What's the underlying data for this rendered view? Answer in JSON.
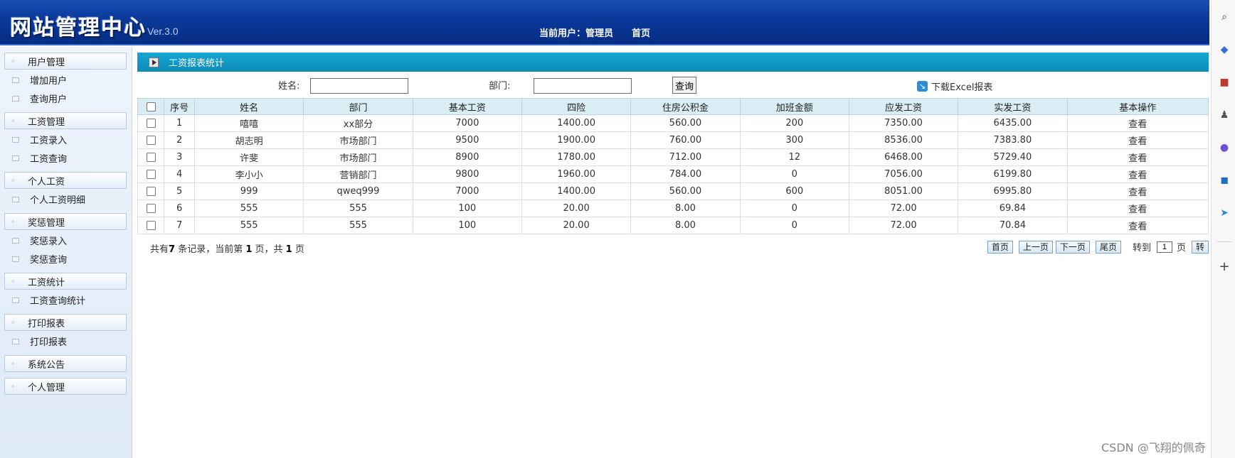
{
  "header": {
    "logo": "网站管理中心",
    "version": "Ver.3.0",
    "current_user_label": "当前用户：管理员",
    "home_link": "首页"
  },
  "sidebar": {
    "groups": [
      {
        "label": "用户管理",
        "items": [
          "增加用户",
          "查询用户"
        ]
      },
      {
        "label": "工资管理",
        "items": [
          "工资录入",
          "工资查询"
        ]
      },
      {
        "label": "个人工资",
        "items": [
          "个人工资明细"
        ]
      },
      {
        "label": "奖惩管理",
        "items": [
          "奖惩录入",
          "奖惩查询"
        ]
      },
      {
        "label": "工资统计",
        "items": [
          "工资查询统计"
        ]
      },
      {
        "label": "打印报表",
        "items": [
          "打印报表"
        ]
      },
      {
        "label": "系统公告",
        "items": []
      },
      {
        "label": "个人管理",
        "items": []
      }
    ]
  },
  "main": {
    "title": "工资报表统计",
    "search": {
      "name_label": "姓名:",
      "name_value": "",
      "dept_label": "部门:",
      "dept_value": "",
      "query_button": "查询",
      "excel_label": "下载Excel报表"
    },
    "table": {
      "headers": [
        "序号",
        "姓名",
        "部门",
        "基本工资",
        "四险",
        "住房公积金",
        "加班金额",
        "应发工资",
        "实发工资",
        "基本操作"
      ],
      "rows": [
        [
          "1",
          "嘻嘻",
          "xx部分",
          "7000",
          "1400.00",
          "560.00",
          "200",
          "7350.00",
          "6435.00",
          "查看"
        ],
        [
          "2",
          "胡志明",
          "市场部门",
          "9500",
          "1900.00",
          "760.00",
          "300",
          "8536.00",
          "7383.80",
          "查看"
        ],
        [
          "3",
          "许斐",
          "市场部门",
          "8900",
          "1780.00",
          "712.00",
          "12",
          "6468.00",
          "5729.40",
          "查看"
        ],
        [
          "4",
          "李小小",
          "营销部门",
          "9800",
          "1960.00",
          "784.00",
          "0",
          "7056.00",
          "6199.80",
          "查看"
        ],
        [
          "5",
          "999",
          "qweq999",
          "7000",
          "1400.00",
          "560.00",
          "600",
          "8051.00",
          "6995.80",
          "查看"
        ],
        [
          "6",
          "555",
          "555",
          "100",
          "20.00",
          "8.00",
          "0",
          "72.00",
          "69.84",
          "查看"
        ],
        [
          "7",
          "555",
          "555",
          "100",
          "20.00",
          "8.00",
          "0",
          "72.00",
          "70.84",
          "查看"
        ]
      ]
    },
    "footer": {
      "prefix": "共有",
      "total": "7",
      "mid": " 条记录，当前第 ",
      "current": "1",
      "mid2": " 页，共 ",
      "pages": "1",
      "suffix": " 页"
    },
    "pager": {
      "first": "首页",
      "prev": "上一页",
      "next": "下一页",
      "last": "尾页",
      "goto_label": "转到",
      "page_value": "1",
      "page_suffix": "页",
      "go": "转"
    }
  },
  "rail_icons": [
    "search-icon",
    "tag-icon",
    "briefcase-icon",
    "chess-icon",
    "office-icon",
    "outlook-icon",
    "send-icon",
    "plus-icon"
  ],
  "watermark": "CSDN @飞翔的佩奇"
}
